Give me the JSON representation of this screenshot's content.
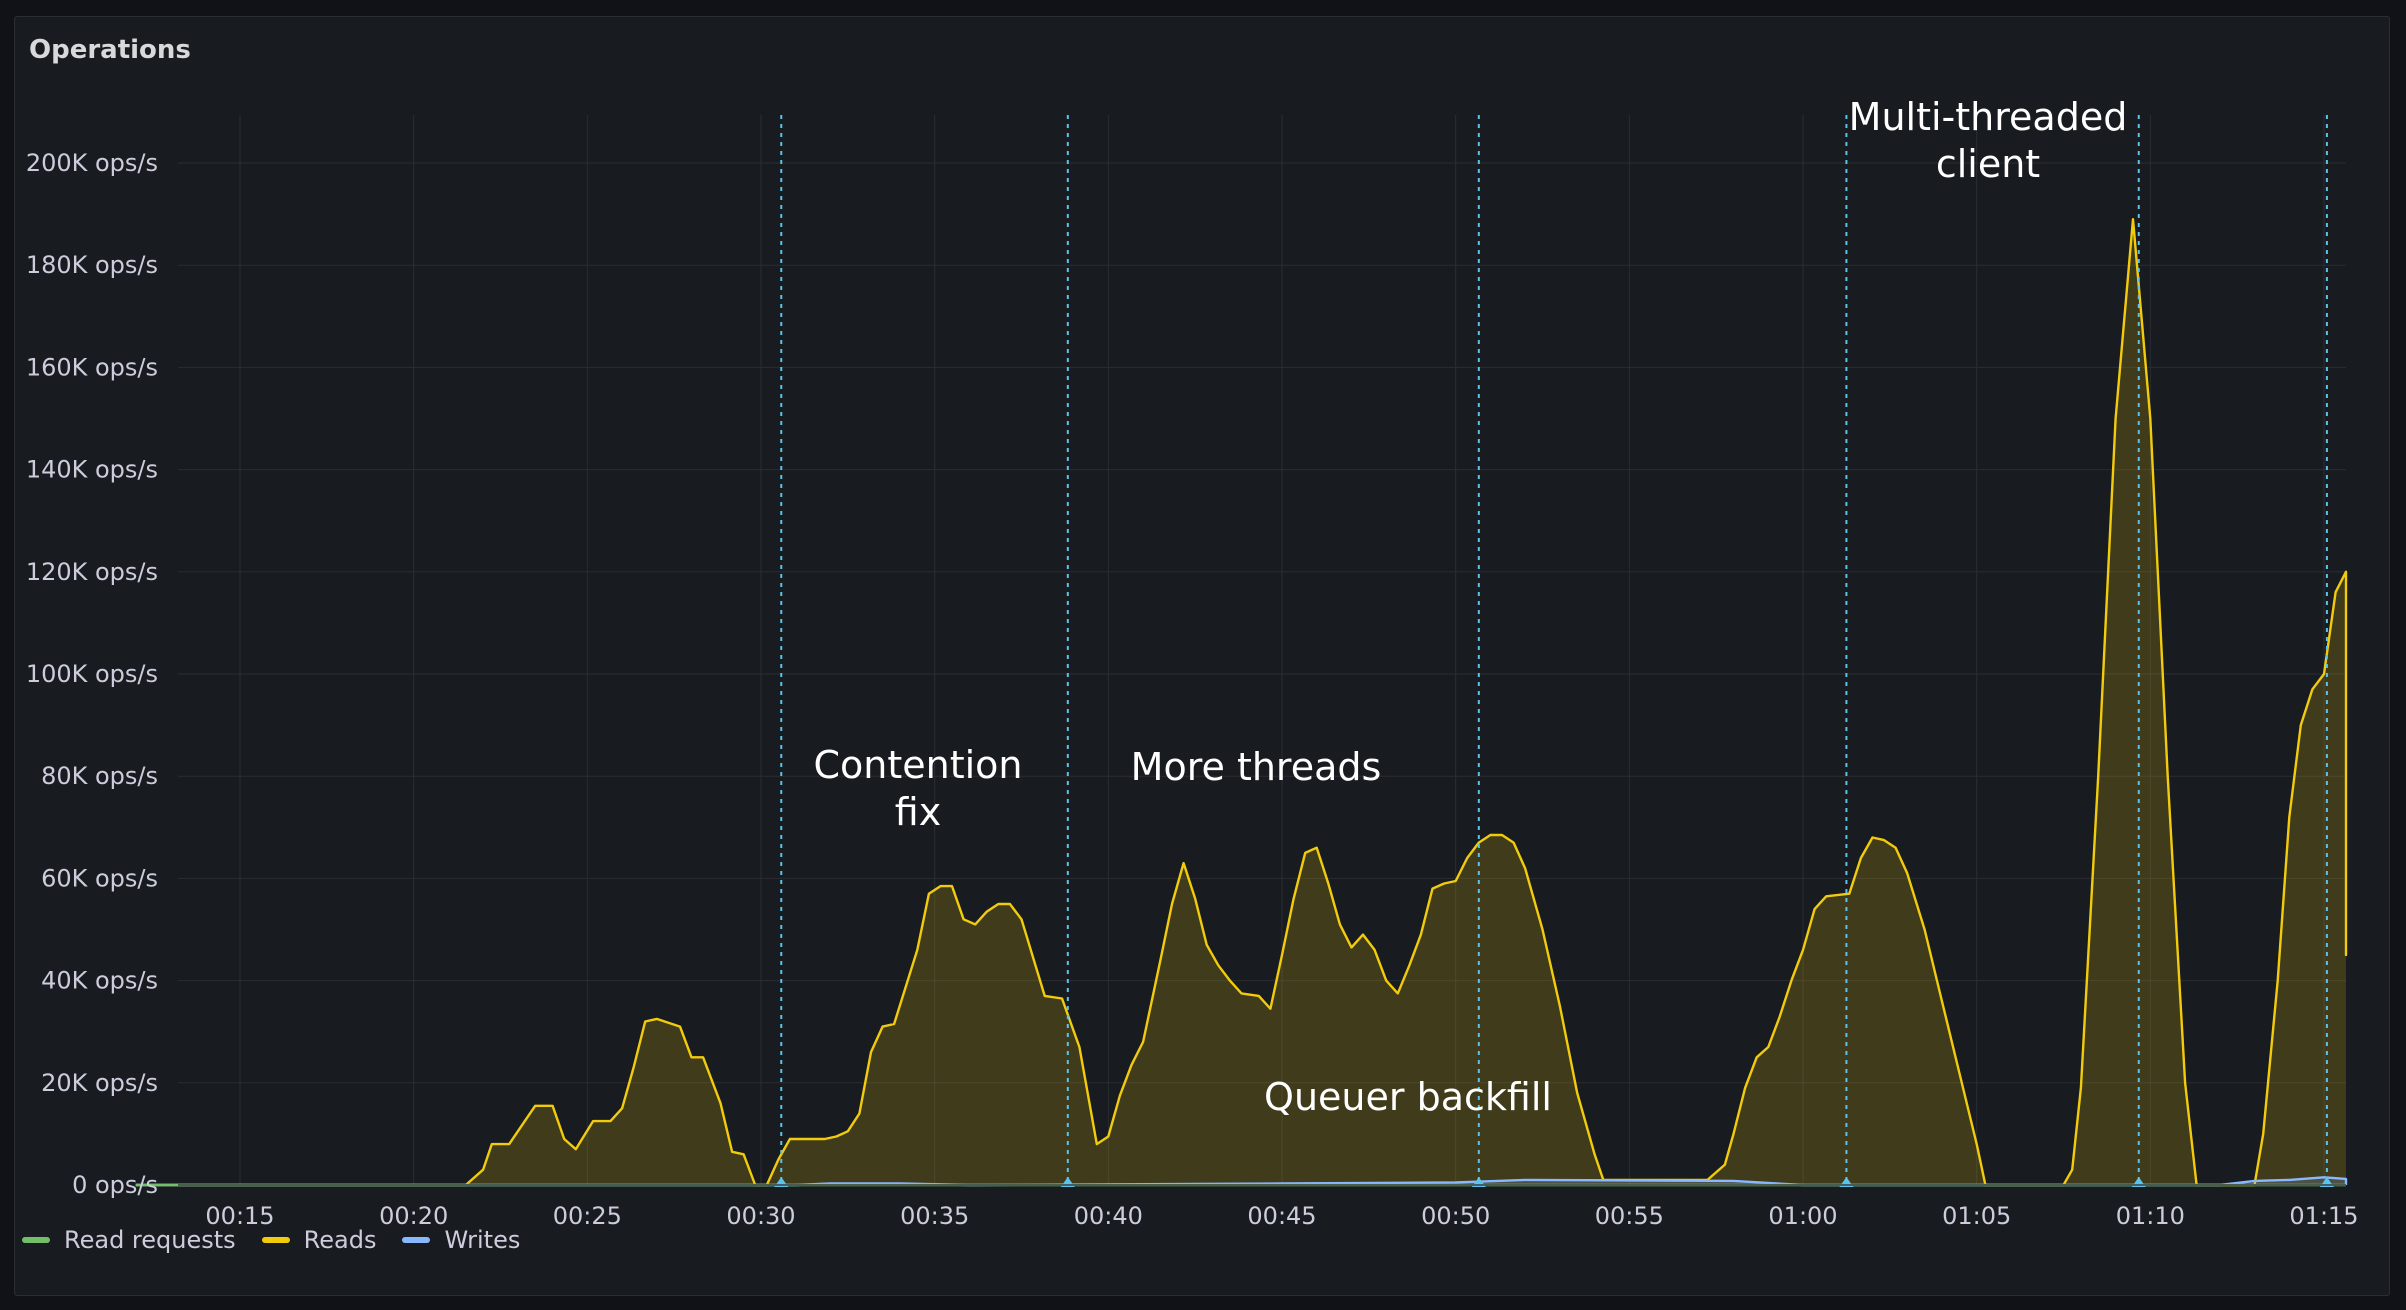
{
  "panel": {
    "title": "Operations"
  },
  "colors": {
    "reads": "#f2cc0c",
    "writes": "#8ab8ff",
    "read_requests": "#73bf69",
    "annotation": "#5bc4e8",
    "grid": "#2a2d32",
    "text": "#ccccdc"
  },
  "chart_data": {
    "type": "area",
    "title": "Operations",
    "xlabel": "",
    "ylabel": "",
    "x_unit": "time",
    "xlim": [
      "00:12:00",
      "01:16:30"
    ],
    "ylim": [
      0,
      210000
    ],
    "y_ticks": [
      0,
      20000,
      40000,
      60000,
      80000,
      100000,
      120000,
      140000,
      160000,
      180000,
      200000
    ],
    "y_tick_labels": [
      "0 ops/s",
      "20K ops/s",
      "40K ops/s",
      "60K ops/s",
      "80K ops/s",
      "100K ops/s",
      "120K ops/s",
      "140K ops/s",
      "160K ops/s",
      "180K ops/s",
      "200K ops/s"
    ],
    "x_tick_labels": [
      "00:15",
      "00:20",
      "00:25",
      "00:30",
      "00:35",
      "00:40",
      "00:45",
      "00:50",
      "00:55",
      "01:00",
      "01:05",
      "01:10",
      "01:15"
    ],
    "grid": true,
    "legend_position": "bottom-left",
    "legend": [
      "Read requests",
      "Reads",
      "Writes"
    ],
    "series": [
      {
        "name": "Reads",
        "color": "#f2cc0c",
        "points": [
          [
            "00:12",
            0
          ],
          [
            "00:20",
            0
          ],
          [
            "00:21:30",
            0
          ],
          [
            "00:22:00",
            3000
          ],
          [
            "00:22:15",
            8000
          ],
          [
            "00:22:45",
            8000
          ],
          [
            "00:23:15",
            13000
          ],
          [
            "00:23:30",
            15500
          ],
          [
            "00:24:00",
            15500
          ],
          [
            "00:24:20",
            9000
          ],
          [
            "00:24:40",
            7000
          ],
          [
            "00:25:10",
            12500
          ],
          [
            "00:25:40",
            12500
          ],
          [
            "00:26:00",
            15000
          ],
          [
            "00:26:20",
            23000
          ],
          [
            "00:26:40",
            32000
          ],
          [
            "00:27:00",
            32500
          ],
          [
            "00:27:40",
            31000
          ],
          [
            "00:28:00",
            25000
          ],
          [
            "00:28:20",
            25000
          ],
          [
            "00:28:50",
            16000
          ],
          [
            "00:29:10",
            6500
          ],
          [
            "00:29:30",
            6000
          ],
          [
            "00:29:50",
            0
          ],
          [
            "00:30:10",
            0
          ],
          [
            "00:30:30",
            5000
          ],
          [
            "00:30:50",
            9000
          ],
          [
            "00:31:50",
            9000
          ],
          [
            "00:32:10",
            9500
          ],
          [
            "00:32:30",
            10500
          ],
          [
            "00:32:50",
            14000
          ],
          [
            "00:33:10",
            26000
          ],
          [
            "00:33:30",
            31000
          ],
          [
            "00:33:50",
            31500
          ],
          [
            "00:34:30",
            46000
          ],
          [
            "00:34:50",
            57000
          ],
          [
            "00:35:10",
            58500
          ],
          [
            "00:35:30",
            58500
          ],
          [
            "00:35:50",
            52000
          ],
          [
            "00:36:10",
            51000
          ],
          [
            "00:36:30",
            53500
          ],
          [
            "00:36:50",
            55000
          ],
          [
            "00:37:10",
            55000
          ],
          [
            "00:37:30",
            52000
          ],
          [
            "00:38:10",
            37000
          ],
          [
            "00:38:40",
            36500
          ],
          [
            "00:39:10",
            27000
          ],
          [
            "00:39:40",
            8000
          ],
          [
            "00:40:00",
            9500
          ],
          [
            "00:40:20",
            17500
          ],
          [
            "00:40:40",
            23500
          ],
          [
            "00:41:00",
            28000
          ],
          [
            "00:41:30",
            44000
          ],
          [
            "00:41:50",
            55000
          ],
          [
            "00:42:10",
            63000
          ],
          [
            "00:42:30",
            56000
          ],
          [
            "00:42:50",
            47000
          ],
          [
            "00:43:10",
            43000
          ],
          [
            "00:43:30",
            40000
          ],
          [
            "00:43:50",
            37500
          ],
          [
            "00:44:20",
            37000
          ],
          [
            "00:44:40",
            34500
          ],
          [
            "00:45:00",
            45000
          ],
          [
            "00:45:20",
            56000
          ],
          [
            "00:45:40",
            65000
          ],
          [
            "00:46:00",
            66000
          ],
          [
            "00:46:20",
            59000
          ],
          [
            "00:46:40",
            51000
          ],
          [
            "00:47:00",
            46500
          ],
          [
            "00:47:20",
            49000
          ],
          [
            "00:47:40",
            46000
          ],
          [
            "00:48:00",
            40000
          ],
          [
            "00:48:20",
            37500
          ],
          [
            "00:48:40",
            43000
          ],
          [
            "00:49:00",
            49000
          ],
          [
            "00:49:20",
            58000
          ],
          [
            "00:49:40",
            59000
          ],
          [
            "00:50:00",
            59500
          ],
          [
            "00:50:20",
            64000
          ],
          [
            "00:50:40",
            67000
          ],
          [
            "00:51:00",
            68500
          ],
          [
            "00:51:20",
            68500
          ],
          [
            "00:51:40",
            67000
          ],
          [
            "00:52:00",
            62000
          ],
          [
            "00:52:30",
            50000
          ],
          [
            "00:53:00",
            35000
          ],
          [
            "00:53:30",
            18000
          ],
          [
            "00:54:00",
            6000
          ],
          [
            "00:54:15",
            1000
          ],
          [
            "00:56:00",
            1000
          ],
          [
            "00:57:15",
            1000
          ],
          [
            "00:57:45",
            4000
          ],
          [
            "00:58:00",
            10000
          ],
          [
            "00:58:20",
            19000
          ],
          [
            "00:58:40",
            25000
          ],
          [
            "00:59:00",
            27000
          ],
          [
            "00:59:20",
            33000
          ],
          [
            "00:59:40",
            40000
          ],
          [
            "01:00:00",
            46000
          ],
          [
            "01:00:20",
            54000
          ],
          [
            "01:00:40",
            56500
          ],
          [
            "01:01:20",
            57000
          ],
          [
            "01:01:40",
            64000
          ],
          [
            "01:02:00",
            68000
          ],
          [
            "01:02:20",
            67500
          ],
          [
            "01:02:40",
            66000
          ],
          [
            "01:03:00",
            61000
          ],
          [
            "01:03:30",
            50000
          ],
          [
            "01:04:00",
            36000
          ],
          [
            "01:04:30",
            22000
          ],
          [
            "01:05:00",
            8000
          ],
          [
            "01:05:15",
            0
          ],
          [
            "01:06:00",
            0
          ],
          [
            "01:07:30",
            0
          ],
          [
            "01:07:45",
            3000
          ],
          [
            "01:08:00",
            19000
          ],
          [
            "01:08:30",
            80000
          ],
          [
            "01:09:00",
            150000
          ],
          [
            "01:09:30",
            189000
          ],
          [
            "01:10:00",
            150000
          ],
          [
            "01:10:30",
            80000
          ],
          [
            "01:11:00",
            20000
          ],
          [
            "01:11:20",
            0
          ],
          [
            "01:12:00",
            0
          ],
          [
            "01:13:00",
            0
          ],
          [
            "01:13:15",
            10000
          ],
          [
            "01:13:40",
            40000
          ],
          [
            "01:14:00",
            72000
          ],
          [
            "01:14:20",
            90000
          ],
          [
            "01:14:40",
            97000
          ],
          [
            "01:15:00",
            100000
          ],
          [
            "01:15:20",
            116000
          ],
          [
            "01:15:40",
            120000
          ],
          [
            "01:16:00",
            117000
          ],
          [
            "01:16:20",
            115000
          ],
          [
            "01:16:40",
            116000
          ],
          [
            "01:17:00",
            108000
          ],
          [
            "01:17:20",
            105000
          ],
          [
            "01:17:40",
            96000
          ],
          [
            "01:18:00",
            59000
          ],
          [
            "01:18:20",
            50000
          ],
          [
            "01:18:40",
            48000
          ],
          [
            "01:19:00",
            45000
          ],
          [
            "01:19:20",
            62000
          ],
          [
            "01:19:40",
            78000
          ],
          [
            "01:20:00",
            79000
          ],
          [
            "01:20:20",
            81000
          ],
          [
            "01:20:40",
            82000
          ],
          [
            "01:21:00",
            90000
          ],
          [
            "01:21:20",
            96000
          ],
          [
            "01:21:40",
            85000
          ],
          [
            "01:22:00",
            93000
          ]
        ]
      },
      {
        "name": "Writes",
        "color": "#8ab8ff",
        "points": [
          [
            "00:12",
            0
          ],
          [
            "00:31:00",
            0
          ],
          [
            "00:32:00",
            300
          ],
          [
            "00:34:00",
            300
          ],
          [
            "00:36:00",
            0
          ],
          [
            "00:45:00",
            300
          ],
          [
            "00:50:00",
            500
          ],
          [
            "00:52:00",
            1000
          ],
          [
            "00:58:00",
            800
          ],
          [
            "01:00:00",
            0
          ],
          [
            "01:12:00",
            0
          ],
          [
            "01:13:00",
            800
          ],
          [
            "01:14:00",
            1000
          ],
          [
            "01:15:00",
            1500
          ],
          [
            "01:17:00",
            1200
          ],
          [
            "01:19:00",
            1000
          ],
          [
            "01:21:00",
            300
          ],
          [
            "01:22:00",
            0
          ]
        ]
      },
      {
        "name": "Read requests",
        "color": "#73bf69",
        "points": [
          [
            "00:12",
            0
          ],
          [
            "01:22:00",
            0
          ]
        ]
      }
    ],
    "annotations": [
      {
        "time": "00:30:35",
        "label": ""
      },
      {
        "time": "00:38:50",
        "label": "Contention fix"
      },
      {
        "time": "00:50:40",
        "label": "More threads"
      },
      {
        "time": "01:01:15",
        "label": "Queuer backfill"
      },
      {
        "time": "01:09:40",
        "label": "Multi-threaded client"
      },
      {
        "time": "01:15:05",
        "label": ""
      }
    ]
  }
}
